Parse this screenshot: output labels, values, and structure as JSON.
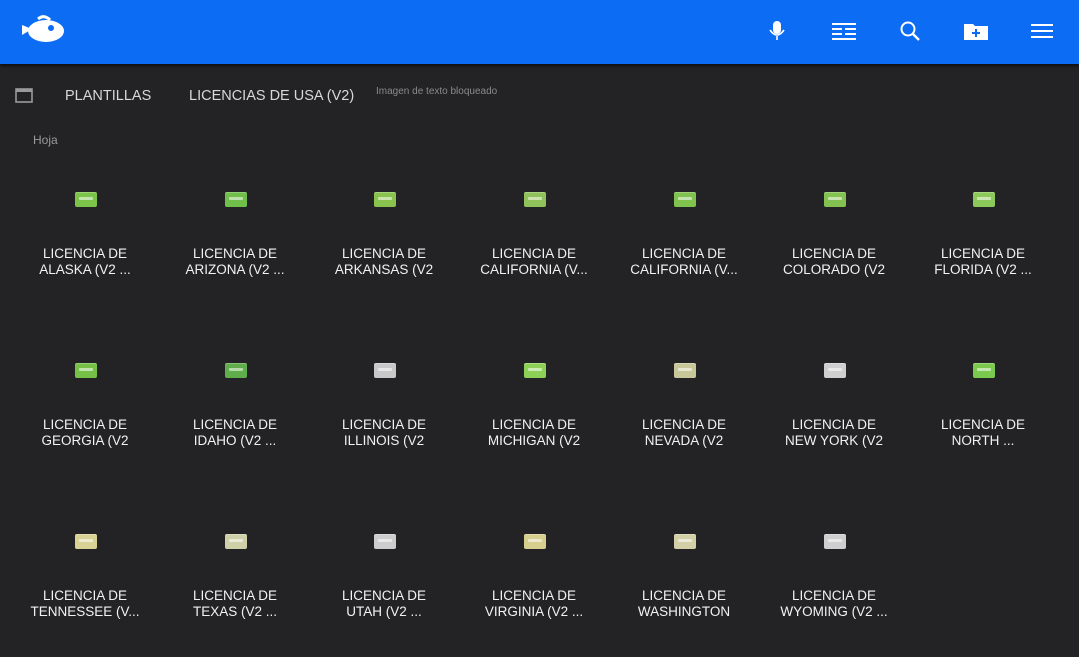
{
  "topbar": {
    "color": "#0c6cf3",
    "icons": [
      "microphone-icon",
      "list-view-icon",
      "search-icon",
      "new-folder-icon",
      "menu-icon"
    ]
  },
  "breadcrumb": {
    "items": [
      "PLANTILLAS",
      "LICENCIAS DE USA (V2)"
    ],
    "current": "Imagen de texto bloqueado"
  },
  "section_title": "Hoja",
  "files": [
    {
      "line1": "LICENCIA DE",
      "line2": "ALASKA (V2 ...",
      "thumb": "#7cc34a"
    },
    {
      "line1": "LICENCIA DE",
      "line2": "ARIZONA (V2 ...",
      "thumb": "#6fbf4a"
    },
    {
      "line1": "LICENCIA DE",
      "line2": "ARKANSAS (V2",
      "thumb": "#8ac24e"
    },
    {
      "line1": "LICENCIA DE",
      "line2": "CALIFORNIA (V...",
      "thumb": "#8fc25a"
    },
    {
      "line1": "LICENCIA DE",
      "line2": "CALIFORNIA (V...",
      "thumb": "#7fc24e"
    },
    {
      "line1": "LICENCIA DE",
      "line2": "COLORADO (V2",
      "thumb": "#83c250"
    },
    {
      "line1": "LICENCIA DE",
      "line2": "FLORIDA (V2 ...",
      "thumb": "#8cc85a"
    },
    {
      "line1": "LICENCIA DE",
      "line2": "GEORGIA (V2",
      "thumb": "#76c047"
    },
    {
      "line1": "LICENCIA DE",
      "line2": "IDAHO (V2 ...",
      "thumb": "#5fae4b"
    },
    {
      "line1": "LICENCIA DE",
      "line2": "ILLINOIS (V2",
      "thumb": "#c9c9c9"
    },
    {
      "line1": "LICENCIA DE",
      "line2": "MICHIGAN (V2",
      "thumb": "#8ed057"
    },
    {
      "line1": "LICENCIA DE",
      "line2": "NEVADA (V2",
      "thumb": "#c8c79a"
    },
    {
      "line1": "LICENCIA DE",
      "line2": "NEW YORK (V2",
      "thumb": "#cfcfcf"
    },
    {
      "line1": "LICENCIA DE",
      "line2": "NORTH ...",
      "thumb": "#7cc94f"
    },
    {
      "line1": "LICENCIA DE",
      "line2": "TENNESSEE (V...",
      "thumb": "#d8d394"
    },
    {
      "line1": "LICENCIA DE",
      "line2": "TEXAS (V2 ...",
      "thumb": "#cfcfa8"
    },
    {
      "line1": "LICENCIA DE",
      "line2": "UTAH (V2 ...",
      "thumb": "#cdcdcd"
    },
    {
      "line1": "LICENCIA DE",
      "line2": "VIRGINIA (V2 ...",
      "thumb": "#d6cf8e"
    },
    {
      "line1": "LICENCIA DE",
      "line2": "WASHINGTON",
      "thumb": "#d3cfa6"
    },
    {
      "line1": "LICENCIA DE",
      "line2": "WYOMING (V2 ...",
      "thumb": "#cfcfcf"
    }
  ]
}
